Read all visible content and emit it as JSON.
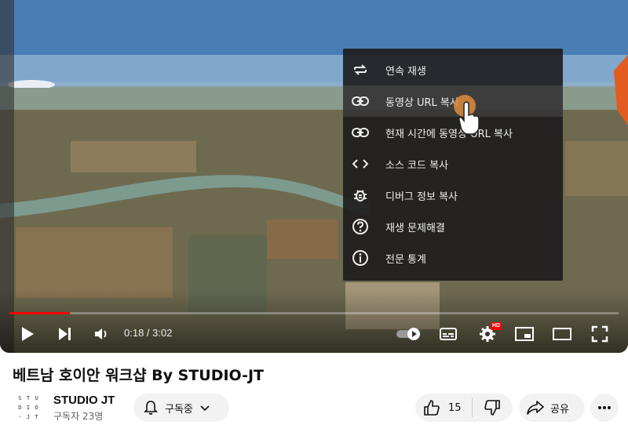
{
  "player": {
    "progress_fraction": 0.099,
    "time_display": "0:18 / 3:02",
    "hd_badge": "HD",
    "controls": {
      "play_icon": "play-icon",
      "next_icon": "next-icon",
      "volume_icon": "volume-icon",
      "autoplay_icon": "autoplay-toggle-icon",
      "subtitles_icon": "subtitles-icon",
      "settings_icon": "settings-gear-icon",
      "miniplayer_icon": "miniplayer-icon",
      "theater_icon": "theater-mode-icon",
      "fullscreen_icon": "fullscreen-icon"
    }
  },
  "context_menu": {
    "items": [
      {
        "label": "연속 재생",
        "icon": "loop-icon"
      },
      {
        "label": "동영상 URL 복사",
        "icon": "link-icon"
      },
      {
        "label": "현재 시간에 동영상 URL 복사",
        "icon": "link-icon"
      },
      {
        "label": "소스 코드 복사",
        "icon": "code-icon"
      },
      {
        "label": "디버그 정보 복사",
        "icon": "bug-icon"
      },
      {
        "label": "재생 문제해결",
        "icon": "help-circle-icon"
      },
      {
        "label": "전문 통계",
        "icon": "info-circle-icon"
      }
    ],
    "hovered_index": 1
  },
  "video": {
    "title": "베트남 호이안 워크샵 By STUDIO-JT"
  },
  "channel": {
    "name": "STUDIO JT",
    "subscribers": "구독자 23명",
    "avatar_letters": [
      "S",
      "T",
      "U",
      "D",
      "I",
      "O",
      "-",
      "J",
      "T"
    ]
  },
  "actions": {
    "subscribed_label": "구독중",
    "like_count": "15",
    "share_label": "공유"
  },
  "colors": {
    "progress": "#ff0000",
    "menu_bg": "#1c1c1c",
    "pill_bg": "#f2f2f2"
  }
}
